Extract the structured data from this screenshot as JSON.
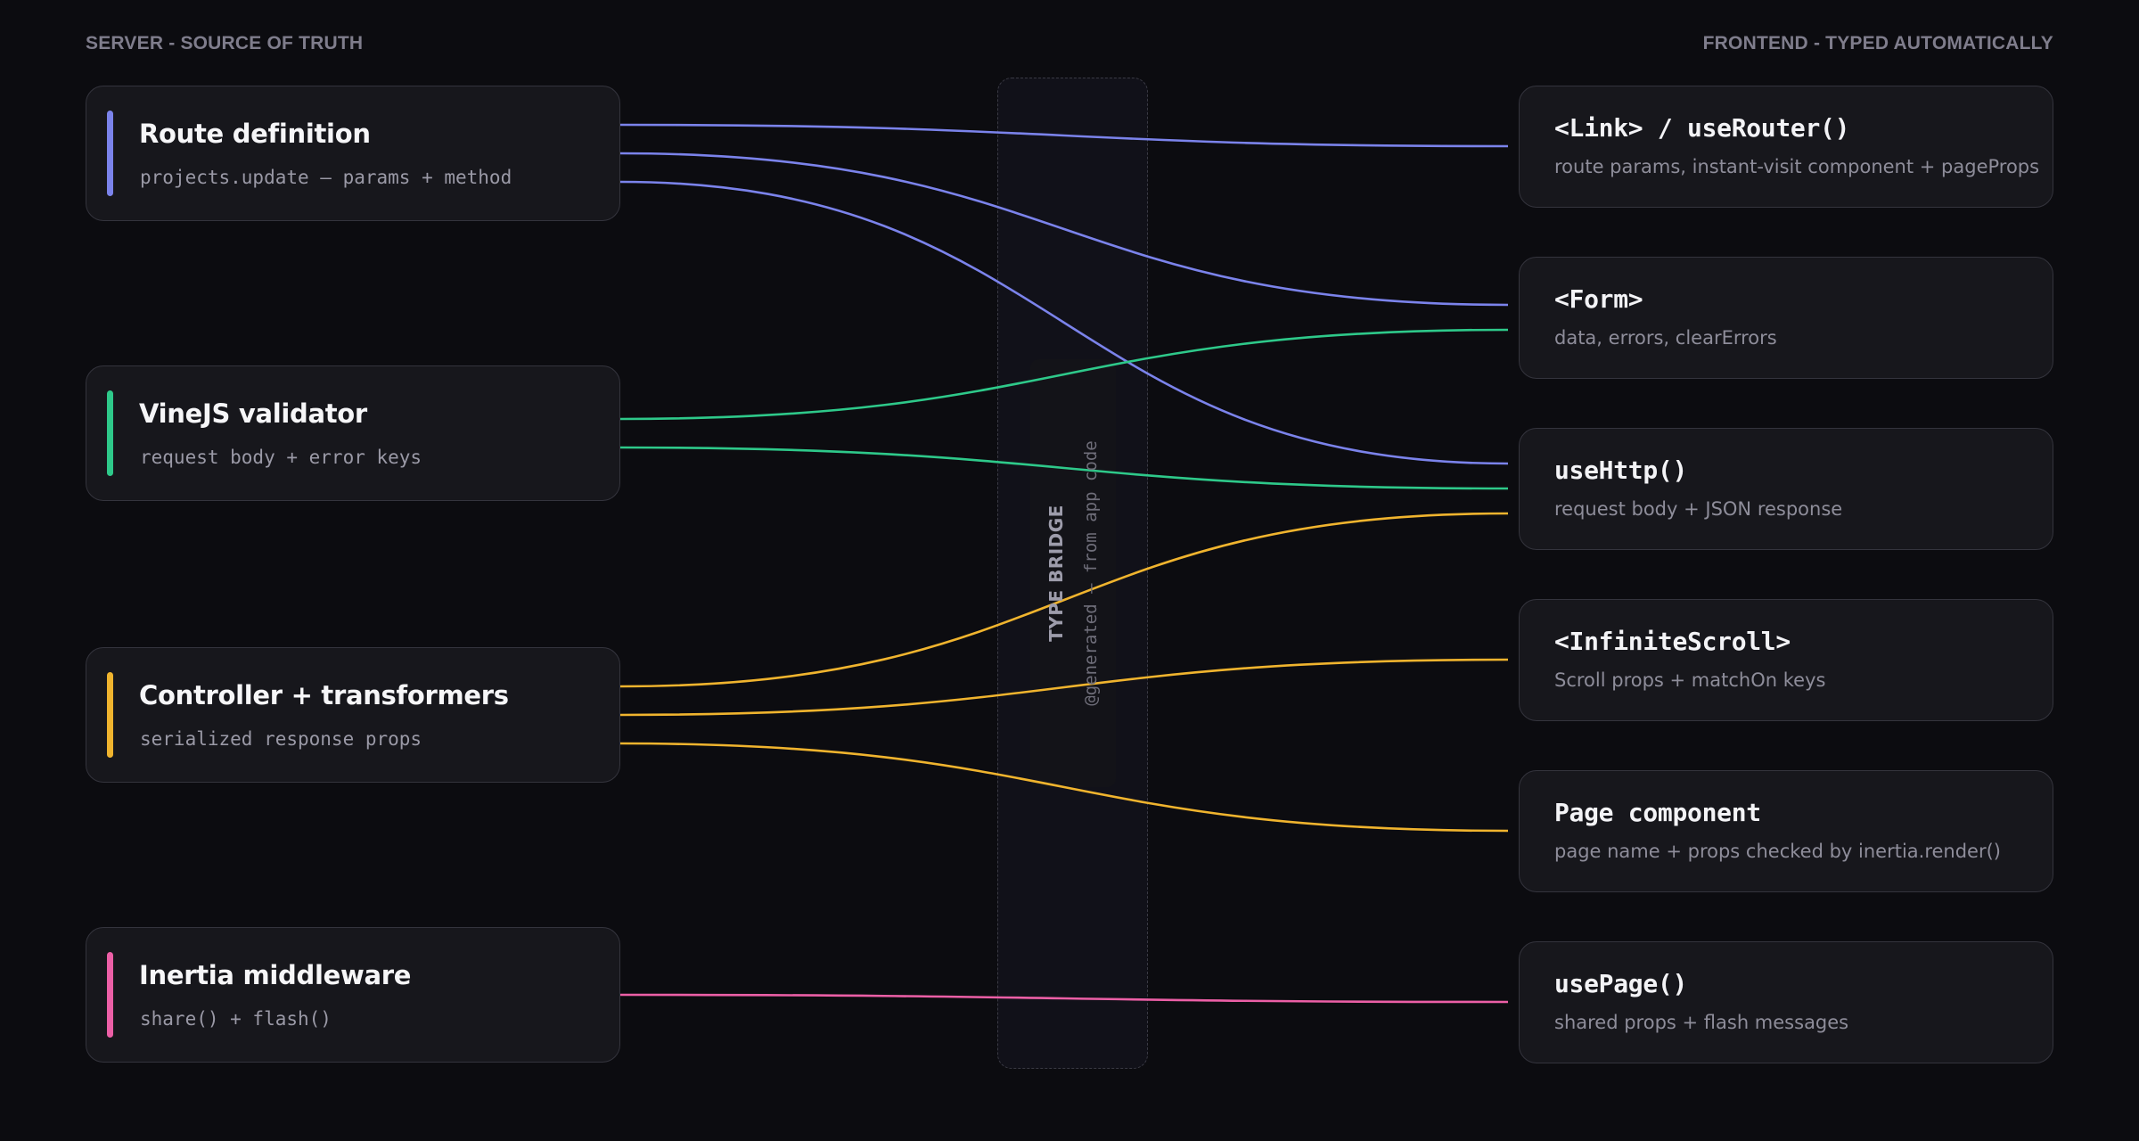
{
  "headers": {
    "left": "SERVER - SOURCE OF TRUTH",
    "right": "FRONTEND - TYPED AUTOMATICALLY"
  },
  "bridge": {
    "title": "TYPE BRIDGE",
    "subtitle": "@generated — from app code"
  },
  "server_nodes": [
    {
      "title": "Route definition",
      "subtitle": "projects.update — params + method",
      "color": "#7b83eb"
    },
    {
      "title": "VineJS validator",
      "subtitle": "request body + error keys",
      "color": "#2ec98a"
    },
    {
      "title": "Controller + transformers",
      "subtitle": "serialized response props",
      "color": "#f0b42e"
    },
    {
      "title": "Inertia middleware",
      "subtitle": "share() + flash()",
      "color": "#ec5fa6"
    }
  ],
  "frontend_nodes": [
    {
      "title": "<Link> / useRouter()",
      "subtitle": "route params, instant-visit component + pageProps"
    },
    {
      "title": "<Form>",
      "subtitle": "data, errors, clearErrors"
    },
    {
      "title": "useHttp()",
      "subtitle": "request body + JSON response"
    },
    {
      "title": "<InfiniteScroll>",
      "subtitle": "Scroll props + matchOn keys"
    },
    {
      "title": "Page component",
      "subtitle": "page name + props checked by inertia.render()"
    },
    {
      "title": "usePage()",
      "subtitle": "shared props + flash messages"
    }
  ],
  "connections": [
    {
      "from": 0,
      "to": 0
    },
    {
      "from": 0,
      "to": 1
    },
    {
      "from": 0,
      "to": 2
    },
    {
      "from": 1,
      "to": 1
    },
    {
      "from": 1,
      "to": 2
    },
    {
      "from": 2,
      "to": 2
    },
    {
      "from": 2,
      "to": 3
    },
    {
      "from": 2,
      "to": 4
    },
    {
      "from": 3,
      "to": 5
    }
  ]
}
